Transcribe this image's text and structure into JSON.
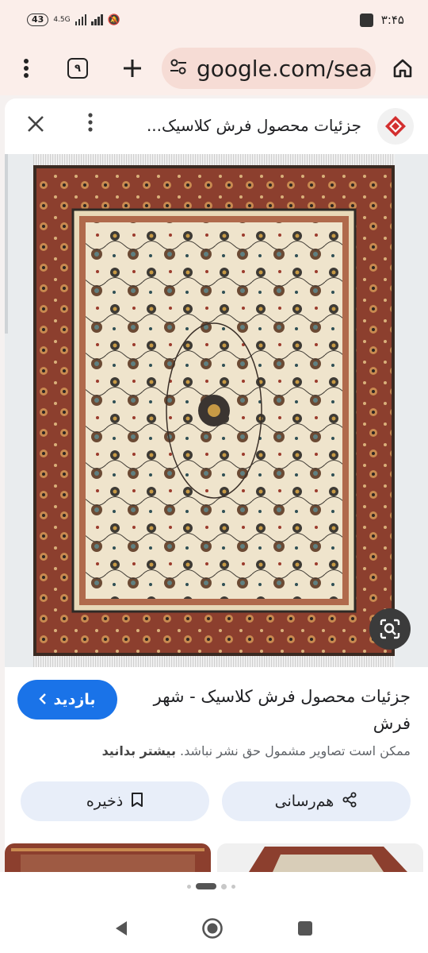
{
  "status": {
    "battery": "43",
    "network": "4.5G",
    "time": "۳:۴۵"
  },
  "browser": {
    "url": "google.com/sea",
    "tab_count": "۹",
    "menu_icon": "more-vert-icon",
    "new_tab_icon": "plus-icon",
    "home_icon": "home-icon",
    "site_info_icon": "tune-icon"
  },
  "panel": {
    "title": "جزئیات محصول فرش کلاسیک...",
    "close_icon": "close-icon",
    "more_icon": "more-vert-icon",
    "site_logo_icon": "site-logo-icon"
  },
  "image": {
    "lens_icon": "google-lens-icon"
  },
  "result": {
    "title": "جزئیات محصول فرش کلاسیک - شهر فرش",
    "copyright_notice": "ممکن است تصاویر مشمول حق نشر نباشد.",
    "learn_more": "بیشتر بدانید",
    "visit_label": "بازدید",
    "share_label": "هم‌رسانی",
    "save_label": "ذخیره"
  },
  "pager": {
    "pages": 4,
    "active_index": 1
  },
  "nav": {
    "back_icon": "back-triangle-icon",
    "home_icon": "home-circle-icon",
    "recents_icon": "recents-square-icon"
  },
  "colors": {
    "accent": "#1a73e8",
    "toolbar_bg": "#fbeeea",
    "url_pill": "#f6dcd5",
    "rug_border": "#8c3f2e",
    "rug_field": "#efe4cc"
  }
}
